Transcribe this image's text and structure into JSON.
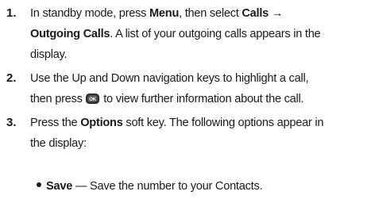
{
  "steps": [
    {
      "number": "1.",
      "line1_pre": "In standby mode, press ",
      "line1_menu": "Menu",
      "line1_mid": ", then select ",
      "line1_calls": "Calls",
      "line1_arrow": " →",
      "line2_outgoing": "Outgoing Calls",
      "line2_rest": ". A list of your outgoing calls appears in the",
      "line3": "display."
    },
    {
      "number": "2.",
      "line1": "Use the Up and Down navigation keys to highlight a call,",
      "line2_pre": "then press ",
      "ok_key_label": "OK",
      "line2_post": " to view further information about the call."
    },
    {
      "number": "3.",
      "line1_pre": "Press the ",
      "line1_options": "Options",
      "line1_post": " soft key. The following options appear in",
      "line2": "the display:"
    }
  ],
  "bullets": [
    {
      "term": "Save",
      "description": " — Save the number to your Contacts."
    }
  ],
  "colors": {
    "text": "#1a1a1a",
    "ok_key_fill": "#3a3a3a"
  }
}
